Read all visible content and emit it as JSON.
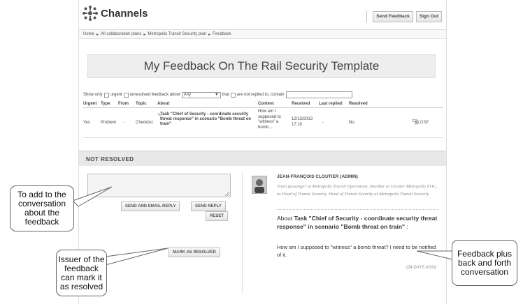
{
  "app": {
    "logo_text": "Channels"
  },
  "header": {
    "send_feedback": "Send Feedback",
    "sign_out": "Sign Out"
  },
  "breadcrumb": [
    {
      "label": "Home"
    },
    {
      "label": "All collaboration plans"
    },
    {
      "label": "Metropolis Transit Security plan"
    },
    {
      "label": "Feedback"
    }
  ],
  "breadcrumb_sep": "▸",
  "page_title": "My Feedback On The Rail Security Template",
  "filter": {
    "show_only": "Show only",
    "urgent": "urgent",
    "unresolved_about": "unresolved feedback about",
    "about_value": "Any",
    "that": "that",
    "not_replied": "are not replied to, contain",
    "contain_value": ""
  },
  "table": {
    "headers": [
      "Urgent",
      "Type",
      "From",
      "Topic",
      "About",
      "Content",
      "Received",
      "Last replied",
      "Resolved"
    ],
    "row": {
      "urgent": "Yes",
      "type": "Problem",
      "from": "-",
      "topic": "Checklist",
      "about": "Task \"Chief of Security - coordinate security threat response\" in scenario \"Bomb threat on train\"",
      "content": "How am I supposed to \"witness\" a bomb...",
      "received": "12/13/2013 17:10",
      "last_replied": "-",
      "resolved": "No",
      "close": "CLOSE"
    }
  },
  "section": {
    "not_resolved": "NOT RESOLVED"
  },
  "reply": {
    "send_email": "SEND AND EMAIL REPLY",
    "send": "SEND REPLY",
    "reset": "RESET",
    "mark_resolved": "MARK AS RESOLVED"
  },
  "feedback": {
    "author": "JEAN-FRANÇOIS CLOUTIER (ADMIN)",
    "bio": "Train passenger at Metropolis Transit Operations. Member at Greater Metropolis EOC, as Head of Transit Security. Head of Transit Security at Metropolis Transit Security.",
    "about_prefix": "About ",
    "about_bold": "Task \"Chief of Security - coordinate security threat response\" in scenario \"Bomb threat on train\"",
    "about_suffix": " :",
    "message": "How am I supposed to \"witness\" a bomb threat? I need to be notified of it.",
    "age": "(24 DAYS AGO)"
  },
  "callouts": {
    "add": "To add to the conversation about the feedback",
    "issuer": "Issuer of the feedback can mark it as resolved",
    "conversation": "Feedback plus back and forth conversation"
  }
}
